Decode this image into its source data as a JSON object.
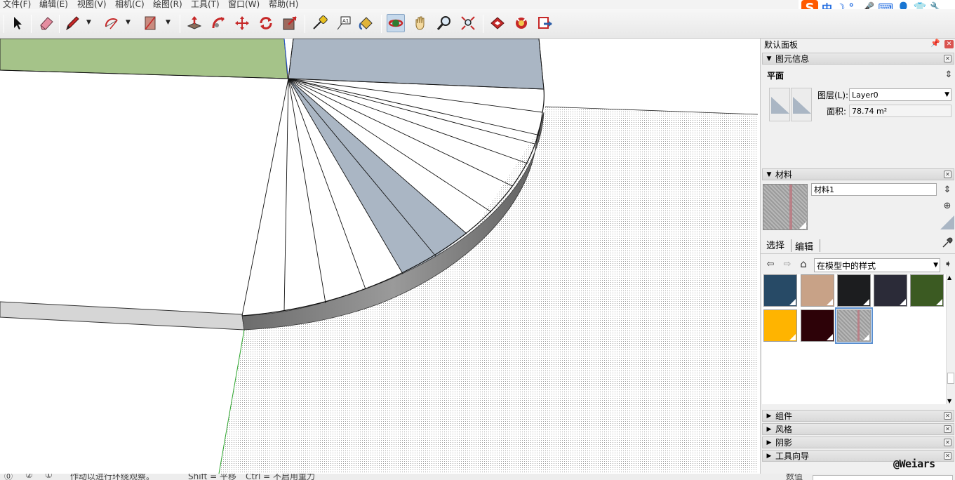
{
  "menubar": {
    "items": [
      "文件(F)",
      "编辑(E)",
      "视图(V)",
      "相机(C)",
      "绘图(R)",
      "工具(T)",
      "窗口(W)",
      "帮助(H)"
    ]
  },
  "ime": {
    "logo": "S",
    "buttons": [
      "中",
      "☽",
      "°,",
      "🎤",
      "⌨",
      "👤",
      "👕",
      "🔧"
    ]
  },
  "toolbar": {
    "tools": [
      "select-tool",
      "eraser-tool",
      "pencil-tool",
      "arc-tool",
      "rectangle-tool",
      "push-pull-tool",
      "follow-me-tool",
      "move-tool",
      "rotate-tool",
      "scale-tool",
      "tape-measure-tool",
      "text-tool",
      "paint-bucket-tool",
      "orbit-tool",
      "pan-tool",
      "zoom-tool",
      "zoom-extents-tool",
      "warehouse-tool",
      "components-tool",
      "share-model-tool"
    ],
    "active_tool": "orbit-tool"
  },
  "statusbar": {
    "items": [
      "⓪",
      "②",
      "①",
      "作动以进行环绕观察。",
      "Shift = 平移",
      "Ctrl = 不启用重力"
    ],
    "measure_label": "数值"
  },
  "panel": {
    "title": "默认面板",
    "entity_info": {
      "header": "图元信息",
      "type": "平面",
      "layer_label": "图层(L):",
      "layer_value": "Layer0",
      "area_label": "面积:",
      "area_value": "78.74 m²"
    },
    "materials": {
      "header": "材料",
      "name_value": "材料1",
      "tabs": [
        "选择",
        "编辑"
      ],
      "collection": "在模型中的样式",
      "swatches": [
        {
          "color": "#274a66"
        },
        {
          "color": "#c8a287"
        },
        {
          "color": "#1c1d1f"
        },
        {
          "color": "#2b2b38"
        },
        {
          "color": "#3b5a22"
        },
        {
          "color": "#ffb400"
        },
        {
          "color": "#2d0208"
        },
        {
          "color": "#a8a8a8",
          "selected": true
        }
      ]
    },
    "collapsed_sections": [
      "组件",
      "风格",
      "阴影",
      "工具向导"
    ]
  },
  "watermark": "@Weiars",
  "colors": {
    "ground_green": "#a5c389",
    "slate_blue": "#aab6c4",
    "pattern": "#aaaaaa",
    "edge_dark": "#707070"
  }
}
